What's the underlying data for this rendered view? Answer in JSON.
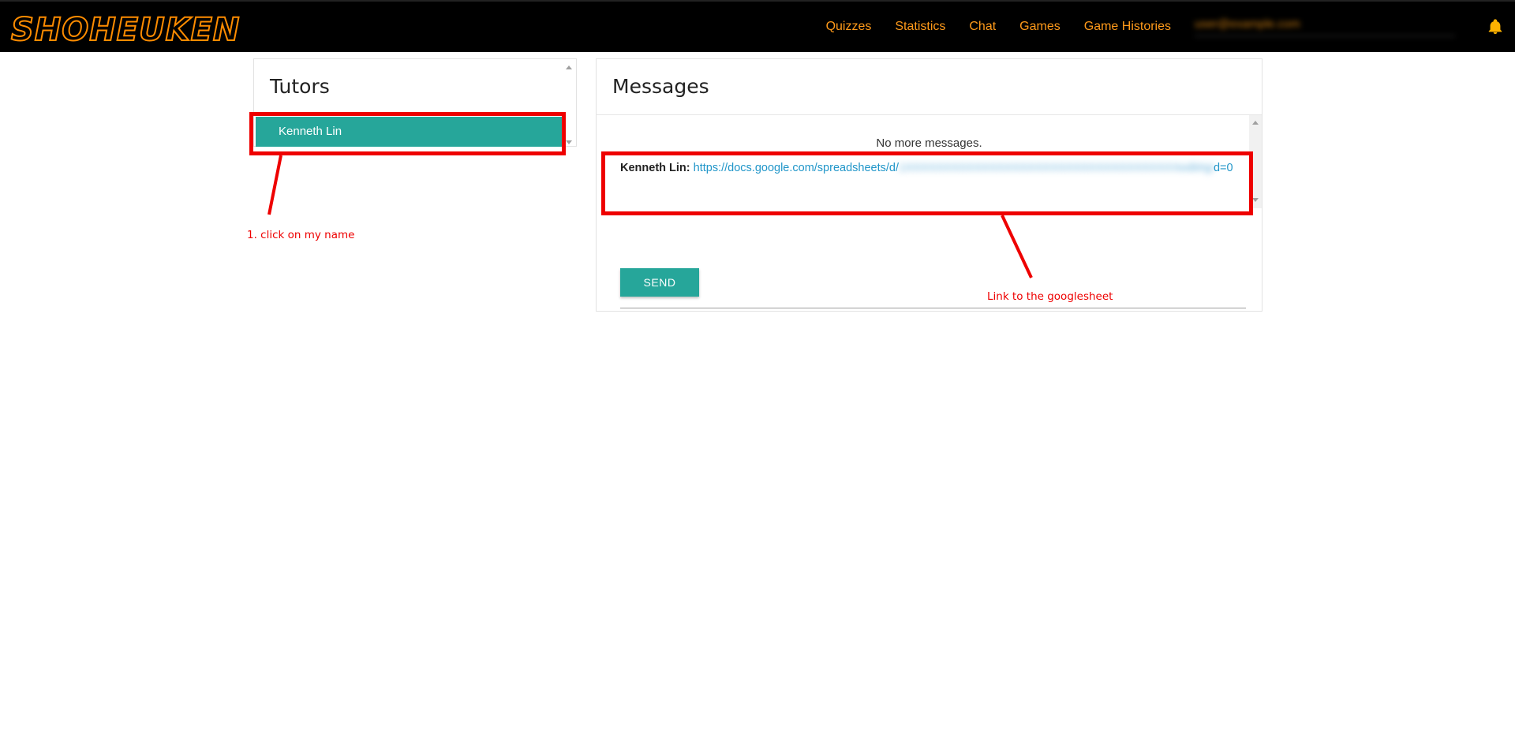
{
  "navbar": {
    "logo": "SHOHEUKEN",
    "links": [
      "Quizzes",
      "Statistics",
      "Chat",
      "Games",
      "Game Histories"
    ],
    "account_email": "user@example.com",
    "icons": [
      "bell-icon"
    ]
  },
  "tutors": {
    "title": "Tutors",
    "items": [
      {
        "name": "Kenneth Lin",
        "selected": true
      }
    ]
  },
  "messages": {
    "title": "Messages",
    "no_more": "No more messages.",
    "items": [
      {
        "author": "Kenneth Lin:",
        "link_visible": "https://docs.google.com/spreadsheets/d/",
        "link_blurred": "1XXXXXXXXXXXXXXXXXXXXXXXXXXXXXXXXXXXXedit#gi",
        "link_end": "d=0"
      }
    ],
    "input_placeholder": "",
    "send_label": "SEND"
  },
  "annotations": {
    "step1": "1. click on my name",
    "link_note": "Link to the googlesheet"
  },
  "colors": {
    "accent": "#26a69a",
    "nav_link": "#ff9a1a",
    "annotation": "#ee0000",
    "link": "#2196c9"
  }
}
